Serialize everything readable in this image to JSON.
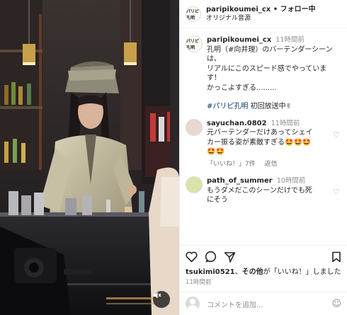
{
  "post": {
    "username": "paripikoumei_cx",
    "separator": "•",
    "follow_status": "フォロー中",
    "audio_label": "オリジナル音源",
    "mute_icon": "speaker-muted-icon",
    "caption": {
      "time": "11時間前",
      "line1": "孔明（#向井理）のバーテンダーシーン",
      "line2": "は、",
      "line3": "リアルにこのスピード感でやっていま",
      "line4": "す！",
      "line5": "かっこよすぎる.........",
      "hashtag": "#パリピ孔明",
      "tail": " 初回放送中✌"
    }
  },
  "comments": [
    {
      "username": "sayuchan.0802",
      "time": "11時間前",
      "line1": "元バーテンダーだけあってシェイ",
      "line2": "カー振る姿が素敵すぎる🤩🤩🤩",
      "line3": "🤩🤩",
      "likes": "「いいね！」7件",
      "reply": "返信"
    },
    {
      "username": "path_of_summer",
      "time": "10時間前",
      "line1": "もうダメだこのシーンだけでも死",
      "line2": "にそう"
    }
  ],
  "actions": {
    "liked_by_user": "tsukimi0521",
    "liked_by_mid": "、",
    "liked_by_others": "その他",
    "liked_by_suffix": "が「いいね！」しました",
    "posted_ago": "11時間前"
  },
  "add_comment": {
    "placeholder": "コメントを追加..."
  },
  "avatar_logo": "パリピ孔明"
}
